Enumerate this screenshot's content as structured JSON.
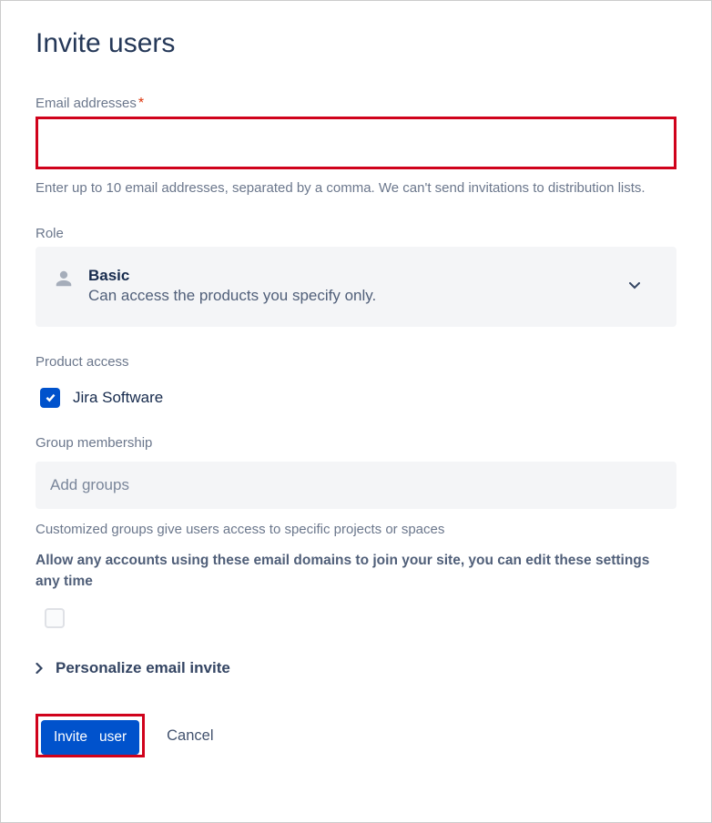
{
  "title": "Invite users",
  "email": {
    "label": "Email addresses",
    "required_mark": "*",
    "help": "Enter up to 10 email addresses, separated by a comma. We can't send invitations to distribution lists."
  },
  "role": {
    "label": "Role",
    "selected_title": "Basic",
    "selected_desc": "Can access the products you specify only."
  },
  "product_access": {
    "label": "Product access",
    "items": [
      {
        "label": "Jira Software",
        "checked": true
      }
    ]
  },
  "group_membership": {
    "label": "Group membership",
    "placeholder": "Add groups",
    "help": "Customized groups give users access to specific projects or spaces"
  },
  "allow_domains": {
    "text": "Allow any accounts using these email domains to join your site, you can edit these settings any time",
    "checked": false
  },
  "personalize": {
    "label": "Personalize email invite"
  },
  "buttons": {
    "invite": "Invite   user",
    "cancel": "Cancel"
  }
}
